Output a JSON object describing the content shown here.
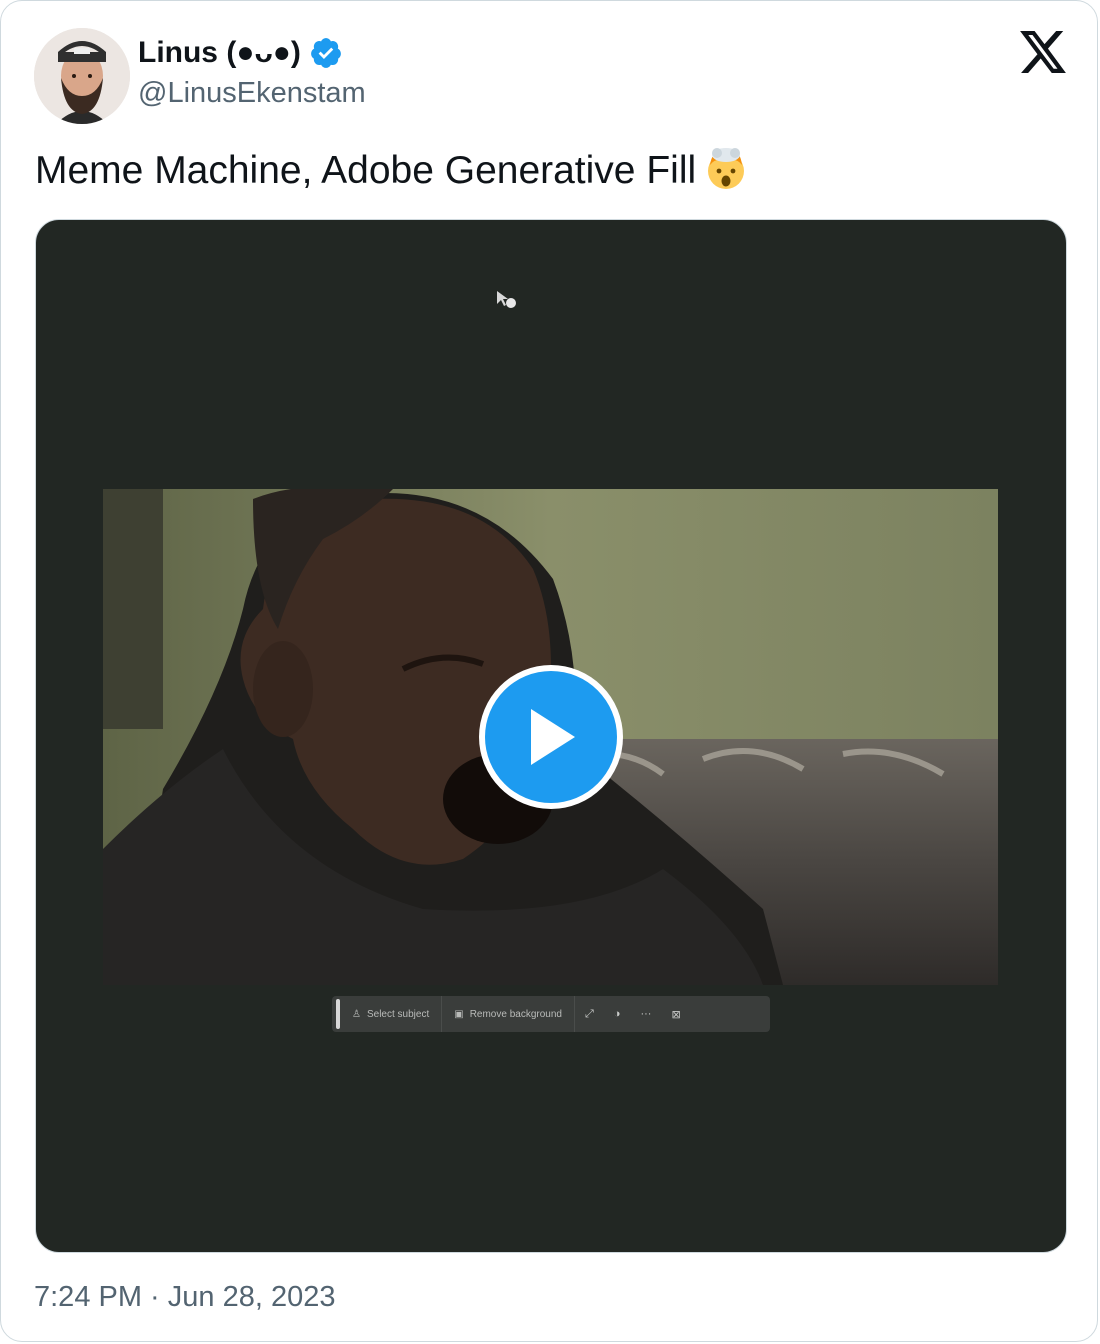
{
  "author": {
    "display_name": "Linus (●ᴗ●)",
    "handle": "@LinusEkenstam",
    "verified": true,
    "avatar_icon": "avatar-bearded-man-cap"
  },
  "platform": {
    "logo_icon": "x-logo-icon"
  },
  "tweet": {
    "text": "Meme Machine, Adobe Generative Fill",
    "emoji_icon": "exploding-head-emoji"
  },
  "media": {
    "type": "video",
    "play_icon": "play-icon",
    "toolbar": {
      "items": [
        "Select subject",
        "Remove background"
      ],
      "icons": [
        "⤢",
        "◑",
        "···",
        "⊠"
      ]
    }
  },
  "timestamp": {
    "time": "7:24 PM",
    "separator": " · ",
    "date": "Jun 28, 2023"
  },
  "colors": {
    "accent": "#1d9bf0",
    "text": "#0f1419",
    "secondary": "#536471",
    "media_bg": "#222723"
  }
}
